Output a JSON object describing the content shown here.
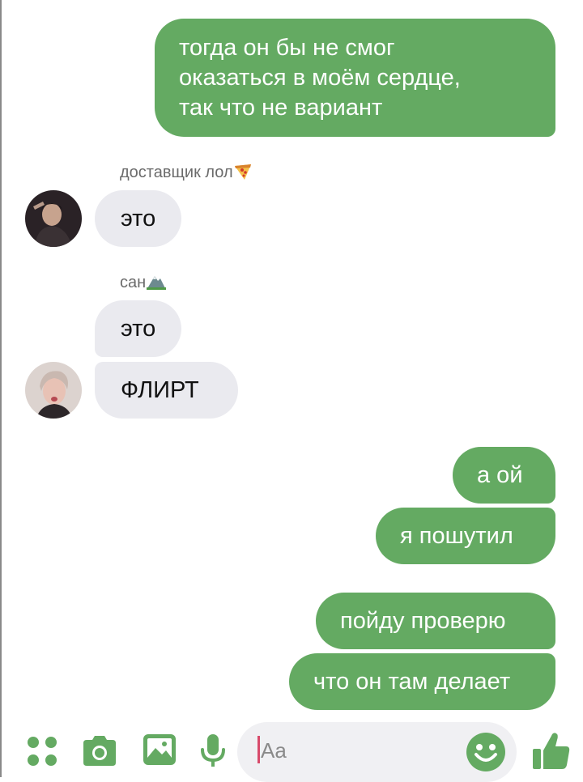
{
  "colors": {
    "accent": "#64aa62",
    "incoming_bubble": "#eaeaef",
    "sender_text": "#6b6b6b"
  },
  "messages": {
    "m1_lines": [
      "тогда он бы не смог",
      "оказаться в моём сердце,",
      "так что не вариант"
    ],
    "sender1": {
      "name": "доставщик лол",
      "emoji_icon": "pizza-emoji-icon"
    },
    "m2": "это",
    "sender2": {
      "name": "сан",
      "emoji_icon": "mountain-emoji-icon"
    },
    "m3": "это",
    "m4": "ФЛИРТ",
    "m5": "а ой",
    "m6": "я пошутил",
    "m7": "пойду проверю",
    "m8": "что он там делает"
  },
  "composer": {
    "placeholder": "Aa"
  },
  "toolbar": {
    "icons": [
      "menu-dots-icon",
      "camera-icon",
      "gallery-icon",
      "microphone-icon",
      "emoji-icon",
      "thumbs-up-icon"
    ]
  }
}
